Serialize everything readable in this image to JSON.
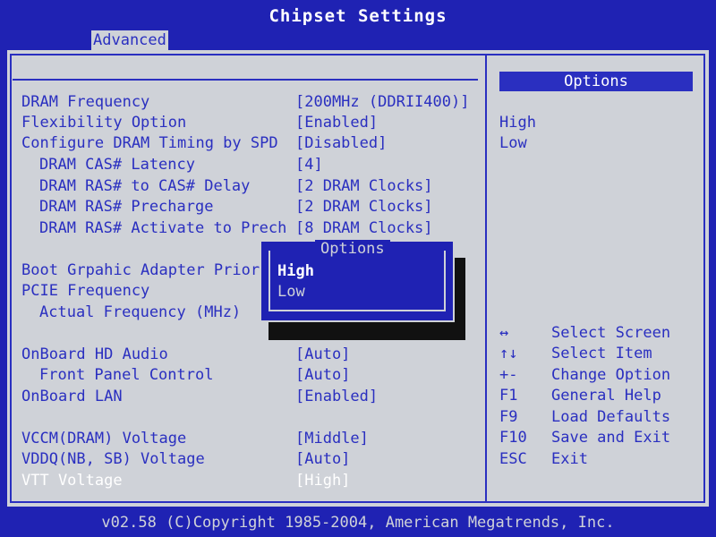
{
  "header": {
    "title": "Chipset Settings",
    "tab": "Advanced"
  },
  "settings": [
    {
      "label": "DRAM Frequency",
      "value": "[200MHz (DDRII400)]"
    },
    {
      "label": "Flexibility Option",
      "value": "[Enabled]"
    },
    {
      "label": "Configure DRAM Timing by SPD",
      "value": "[Disabled]"
    },
    {
      "label": "DRAM CAS# Latency",
      "value": "[4]"
    },
    {
      "label": "DRAM RAS# to CAS# Delay",
      "value": "[2 DRAM Clocks]"
    },
    {
      "label": "DRAM RAS# Precharge",
      "value": "[2 DRAM Clocks]"
    },
    {
      "label": "DRAM RAS# Activate to Precha",
      "value": "[8 DRAM Clocks]"
    },
    {
      "label": "Boot Grpahic Adapter Priori",
      "value": ""
    },
    {
      "label": "PCIE Frequency",
      "value": ""
    },
    {
      "label": "Actual Frequency (MHz)",
      "value": ""
    },
    {
      "label": "OnBoard HD Audio",
      "value": "[Auto]"
    },
    {
      "label": "Front Panel Control",
      "value": "[Auto]"
    },
    {
      "label": "OnBoard LAN",
      "value": "[Enabled]"
    },
    {
      "label": "VCCM(DRAM) Voltage",
      "value": "[Middle]"
    },
    {
      "label": "VDDQ(NB, SB) Voltage",
      "value": "[Auto]"
    },
    {
      "label": "VTT Voltage",
      "value": "[High]"
    }
  ],
  "options_panel": {
    "header": "Options",
    "items": [
      "High",
      "Low"
    ]
  },
  "keys": [
    {
      "key": "↔",
      "desc": "Select Screen"
    },
    {
      "key": "↑↓",
      "desc": "Select Item"
    },
    {
      "key": "+-",
      "desc": "Change Option"
    },
    {
      "key": "F1",
      "desc": "General Help"
    },
    {
      "key": "F9",
      "desc": "Load Defaults"
    },
    {
      "key": "F10",
      "desc": "Save and Exit"
    },
    {
      "key": "ESC",
      "desc": "Exit"
    }
  ],
  "popup": {
    "title": "Options",
    "options": [
      "High",
      "Low"
    ]
  },
  "footer": "v02.58 (C)Copyright 1985-2004, American Megatrends, Inc."
}
